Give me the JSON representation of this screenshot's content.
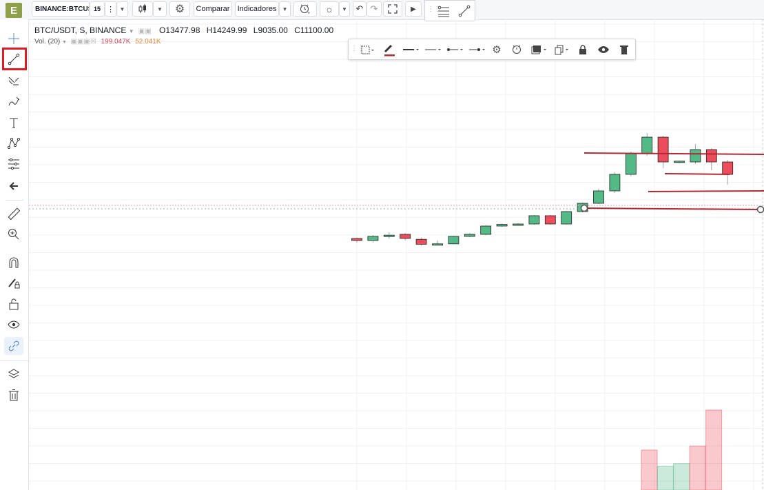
{
  "toolbar": {
    "logo_letter": "E",
    "symbol": "BINANCE:BTCUS",
    "interval": "15",
    "compare_label": "Comparar",
    "indicators_label": "Indicadores"
  },
  "legend": {
    "symbol": "BTC/USDT, S, BINANCE",
    "open": "O13477.98",
    "high": "H14249.99",
    "low": "L9035.00",
    "close": "C11100.00",
    "volume_label": "Vol. (20)",
    "volume_value_1": "199.047K",
    "volume_value_2": "52.041K"
  },
  "left_tools": [
    "crosshair-icon",
    "trend-line-icon",
    "fib-tool-icon",
    "brush-icon",
    "text-icon",
    "pattern-icon",
    "prediction-icon",
    "arrow-left-icon",
    "ruler-icon",
    "zoom-icon",
    "magnet-icon",
    "lock-pencil-icon",
    "unlock-icon",
    "eye-icon",
    "link-icon",
    "layers-icon",
    "trash-icon"
  ],
  "colors": {
    "up": "#53b987",
    "down": "#eb4d5c",
    "drawing": "#b22833",
    "highlight": "#e11b22",
    "logo": "#8ea04c"
  },
  "candles": [
    {
      "o": 0.5,
      "c": 0.45,
      "h": 0.52,
      "l": 0.4
    },
    {
      "o": 0.45,
      "c": 0.55,
      "h": 0.58,
      "l": 0.4
    },
    {
      "o": 0.55,
      "c": 0.58,
      "h": 0.65,
      "l": 0.5
    },
    {
      "o": 0.6,
      "c": 0.5,
      "h": 0.63,
      "l": 0.45
    },
    {
      "o": 0.48,
      "c": 0.36,
      "h": 0.52,
      "l": 0.33
    },
    {
      "o": 0.36,
      "c": 0.37,
      "h": 0.45,
      "l": 0.34
    },
    {
      "o": 0.37,
      "c": 0.55,
      "h": 0.57,
      "l": 0.36
    },
    {
      "o": 0.55,
      "c": 0.6,
      "h": 0.63,
      "l": 0.53
    },
    {
      "o": 0.6,
      "c": 0.8,
      "h": 0.82,
      "l": 0.58
    },
    {
      "o": 0.8,
      "c": 0.84,
      "h": 0.86,
      "l": 0.78
    },
    {
      "o": 0.83,
      "c": 0.85,
      "h": 0.87,
      "l": 0.82
    },
    {
      "o": 0.85,
      "c": 1.05,
      "h": 1.07,
      "l": 0.83
    },
    {
      "o": 1.05,
      "c": 0.85,
      "h": 1.07,
      "l": 0.83
    },
    {
      "o": 0.85,
      "c": 1.15,
      "h": 1.17,
      "l": 0.83
    },
    {
      "o": 1.15,
      "c": 1.35,
      "h": 1.37,
      "l": 1.13
    },
    {
      "o": 1.35,
      "c": 1.65,
      "h": 1.7,
      "l": 1.33
    },
    {
      "o": 1.65,
      "c": 2.05,
      "h": 2.1,
      "l": 1.6
    },
    {
      "o": 2.05,
      "c": 2.55,
      "h": 2.6,
      "l": 2.0
    },
    {
      "o": 2.55,
      "c": 2.95,
      "h": 3.05,
      "l": 2.5
    },
    {
      "o": 2.95,
      "c": 2.35,
      "h": 2.98,
      "l": 2.2
    },
    {
      "o": 2.35,
      "c": 2.37,
      "h": 2.38,
      "l": 2.32
    },
    {
      "o": 2.35,
      "c": 2.65,
      "h": 2.78,
      "l": 2.3
    },
    {
      "o": 2.65,
      "c": 2.35,
      "h": 2.68,
      "l": 2.15
    },
    {
      "o": 2.35,
      "c": 2.05,
      "h": 2.4,
      "l": 1.8
    }
  ],
  "volumes": [
    {
      "v": 0.5,
      "up": false
    },
    {
      "v": 0.3,
      "up": true
    },
    {
      "v": 0.33,
      "up": true
    },
    {
      "v": 0.55,
      "up": false
    },
    {
      "v": 1.0,
      "up": false
    }
  ]
}
